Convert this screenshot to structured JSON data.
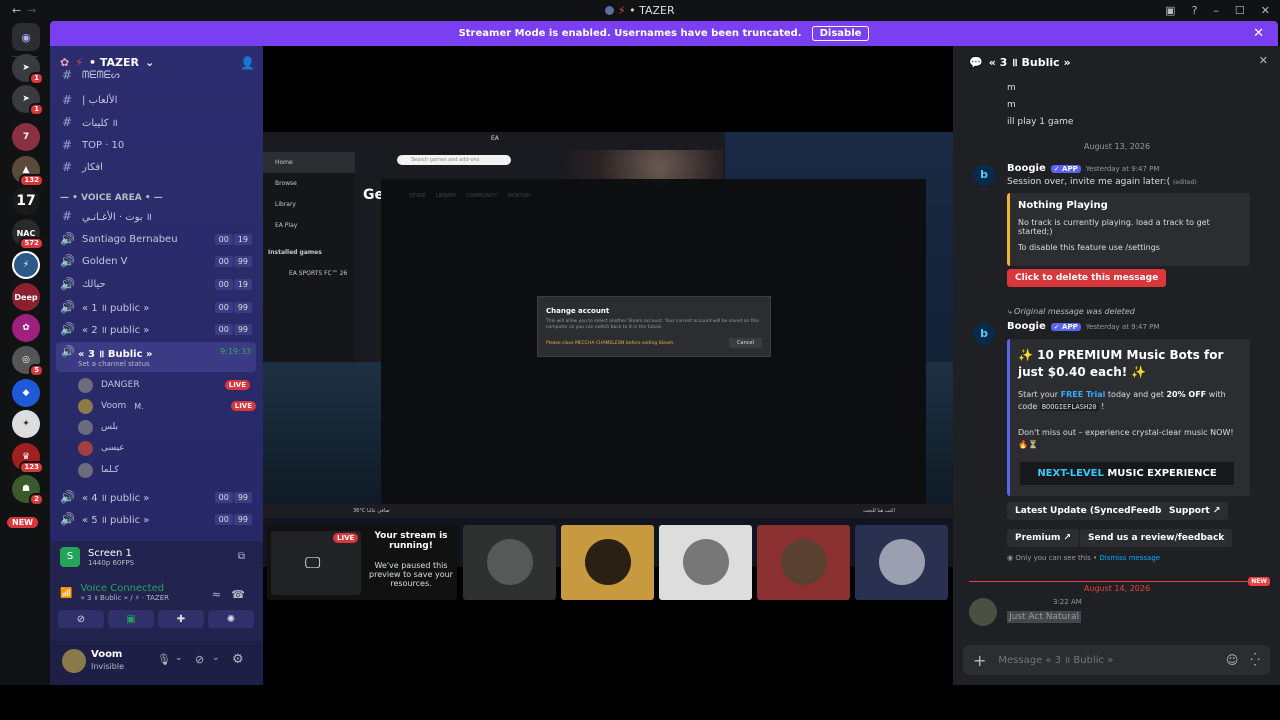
{
  "window": {
    "title": "• TAZER",
    "nav_back": "←",
    "nav_forward": "→"
  },
  "banner": {
    "text": "Streamer Mode is enabled. Usernames have been truncated.",
    "button": "Disable"
  },
  "rail": {
    "badges": [
      "1",
      "1",
      "132",
      "572",
      "5",
      "123",
      "2"
    ],
    "labels": {
      "s17": "17",
      "new": "NEW",
      "deep": "Deep",
      "nac": "NAC"
    }
  },
  "guild": {
    "name": "• TAZER",
    "chevron": "⌄"
  },
  "channels": [
    {
      "icon": "#",
      "name": "ᗰᗴᗰᗴᔕ"
    },
    {
      "icon": "#",
      "name": "| الألعاب"
    },
    {
      "icon": "#",
      "name": "كليبات ॥"
    },
    {
      "icon": "#",
      "name": "TOP · 10"
    },
    {
      "icon": "#",
      "name": "افكار"
    }
  ],
  "voice_category": "• VOICE AREA •",
  "voice_channels": [
    {
      "icon": "#",
      "name": "بوت · الأغـانـي ॥",
      "c1": "",
      "c2": ""
    },
    {
      "icon": "🔊",
      "name": "Santiago Bernabeu",
      "c1": "00",
      "c2": "19"
    },
    {
      "icon": "🔊",
      "name": "Golden V",
      "c1": "00",
      "c2": "99"
    },
    {
      "icon": "🔊",
      "name": "حيالك",
      "c1": "00",
      "c2": "19"
    },
    {
      "icon": "🔊",
      "name": "« 1 ॥ public »",
      "c1": "00",
      "c2": "99"
    },
    {
      "icon": "🔊",
      "name": "« 2 ॥ public »",
      "c1": "00",
      "c2": "99"
    }
  ],
  "active_channel": {
    "name": "« 3 ॥ Bublic »",
    "timer": "9:19:33",
    "status": "Set a channel status"
  },
  "voice_users": [
    {
      "name": "DANGER",
      "live": "LIVE"
    },
    {
      "name": "Voom",
      "extra": "M.",
      "live": "LIVE"
    },
    {
      "name": "بلس",
      "live": ""
    },
    {
      "name": "عيسى",
      "live": ""
    },
    {
      "name": "كـلما",
      "live": ""
    }
  ],
  "voice_channels_after": [
    {
      "icon": "🔊",
      "name": "« 4 ॥ public »",
      "c1": "00",
      "c2": "99"
    },
    {
      "icon": "🔊",
      "name": "« 5 ॥ public »",
      "c1": "00",
      "c2": "99"
    }
  ],
  "screen": {
    "title": "Screen 1",
    "quality": "1440p 60FPS"
  },
  "voice": {
    "status": "Voice Connected",
    "location": "« 3 ॥ Bublic » / ⚡ · TAZER"
  },
  "user": {
    "name": "Voom",
    "status": "Invisible"
  },
  "stream": {
    "ea_title": "EA",
    "ea_nav": [
      "Home",
      "Browse",
      "Library",
      "EA Play"
    ],
    "ea_installed": "Installed games",
    "ea_game": "EA SPORTS FC™ 26",
    "ea_search": "Search games and add-ons",
    "ea_heading": "Ge",
    "steam_tabs": [
      "STORE",
      "LIBRARY",
      "COMMUNITY",
      "MONTOH"
    ],
    "dialog_title": "Change account",
    "dialog_body": "This will allow you to select another Steam account. Your current account will be saved on this computer so you can switch back to it in the future.",
    "dialog_warning": "Please close MECCHA CHAMELEON before exiting Steam.",
    "dialog_cancel": "Cancel",
    "taskbar_weather": "36°C صافي غالبا",
    "taskbar_search": "اكتب هنا للبحث"
  },
  "preview": {
    "live": "LIVE",
    "title": "Your stream is running!",
    "body": "We've paused this preview to save your resources."
  },
  "chat": {
    "channel": "« 3 ॥ Bublic »",
    "early": [
      "m",
      "m",
      "ill play 1 game"
    ],
    "date1": "August 13, 2026",
    "bot": "Boogie",
    "app": "✓ APP",
    "time1": "Yesterday at 9:47 PM",
    "msg1": "Session over, invite me again later:(",
    "edited": "(edited)",
    "embed1": {
      "title": "Nothing Playing",
      "line1": "No track is currently playing. load a track to get started;)",
      "line2": "To disable this feature use /settings"
    },
    "delete_btn": "Click to delete this message",
    "deleted_note": "Original message was deleted",
    "time2": "Yesterday at 9:47 PM",
    "promo": {
      "title": "✨ 10 PREMIUM Music Bots for just $0.40 each! ✨",
      "p1a": "Start your ",
      "p1b": "FREE Trial",
      "p1c": " today and get ",
      "p1d": "20% OFF",
      "p1e": " with code ",
      "code": "BOOGIEFLASH20",
      "p1f": " !",
      "p2": "Don't miss out – experience crystal-clear music NOW! 🔥⏳",
      "banner_a": "NEXT-LEVEL",
      "banner_b": " MUSIC EXPERIENCE"
    },
    "buttons": [
      "Latest Update (SyncedFeedback)",
      "Support",
      "Premium",
      "Send us a review/feedback"
    ],
    "ephemeral": "Only you can see this •",
    "dismiss": "Dismiss message",
    "date2": "August 14, 2026",
    "new": "NEW",
    "time3": "3:22 AM",
    "msg3": "Just Act Natural",
    "placeholder": "Message « 3 ॥ Bublic »"
  },
  "colors": {
    "banner": "#7b3ff2",
    "sidebar": "#2c2d6e",
    "live": "#da373c",
    "app_badge": "#5865f2",
    "embed_border": "#f0b232"
  }
}
